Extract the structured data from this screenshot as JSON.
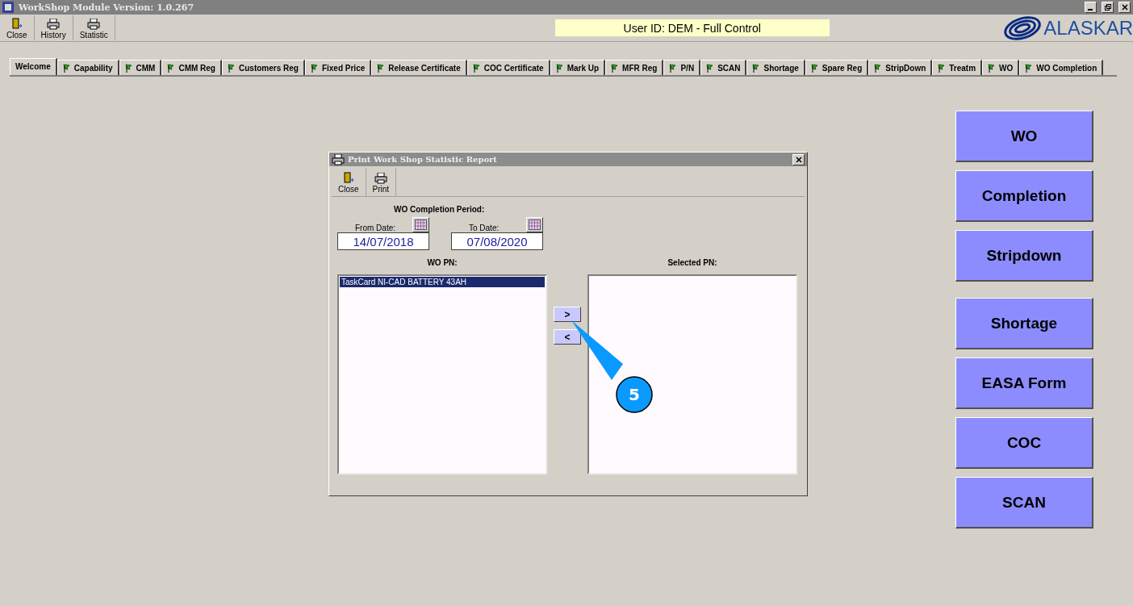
{
  "window": {
    "title": "WorkShop Module  Version: 1.0.267"
  },
  "toolbar": [
    {
      "label": "Close",
      "kind": "door"
    },
    {
      "label": "History",
      "kind": "printer"
    },
    {
      "label": "Statistic",
      "kind": "printer"
    }
  ],
  "user_banner": "User ID: DEM - Full Control",
  "logo": {
    "text": "ALASKAR"
  },
  "tabs": [
    {
      "label": "Welcome",
      "selected": true,
      "flag": false
    },
    {
      "label": "Capability",
      "selected": false,
      "flag": true
    },
    {
      "label": "CMM",
      "selected": false,
      "flag": true
    },
    {
      "label": "CMM Reg",
      "selected": false,
      "flag": true
    },
    {
      "label": "Customers Reg",
      "selected": false,
      "flag": true
    },
    {
      "label": "Fixed Price",
      "selected": false,
      "flag": true
    },
    {
      "label": "Release Certificate",
      "selected": false,
      "flag": true
    },
    {
      "label": "COC Certificate",
      "selected": false,
      "flag": true
    },
    {
      "label": "Mark Up",
      "selected": false,
      "flag": true
    },
    {
      "label": "MFR Reg",
      "selected": false,
      "flag": true
    },
    {
      "label": "P/N",
      "selected": false,
      "flag": true
    },
    {
      "label": "SCAN",
      "selected": false,
      "flag": true
    },
    {
      "label": "Shortage",
      "selected": false,
      "flag": true
    },
    {
      "label": "Spare Reg",
      "selected": false,
      "flag": true
    },
    {
      "label": "StripDown",
      "selected": false,
      "flag": true
    },
    {
      "label": "Treatm",
      "selected": false,
      "flag": true
    },
    {
      "label": "WO",
      "selected": false,
      "flag": true
    },
    {
      "label": "WO Completion",
      "selected": false,
      "flag": true
    }
  ],
  "dialog": {
    "title": "Print Work Shop Statistic Report",
    "toolbar": [
      {
        "label": "Close",
        "kind": "door"
      },
      {
        "label": "Print",
        "kind": "printer"
      }
    ],
    "period_label": "WO Completion Period:",
    "from_date": {
      "label": "From Date:",
      "value": "14/07/2018"
    },
    "to_date": {
      "label": "To Date:",
      "value": "07/08/2020"
    },
    "wo_pn": {
      "label": "WO PN:",
      "items": [
        {
          "text": "TaskCard  NI-CAD BATTERY 43AH",
          "selected": true
        }
      ]
    },
    "move_buttons": [
      ">",
      "<"
    ],
    "selected_pn": {
      "label": "Selected PN:"
    }
  },
  "callout": {
    "number": "5"
  },
  "side_button_groups": [
    {
      "buttons": [
        "WO",
        "Completion",
        "Stripdown"
      ]
    },
    {
      "buttons": [
        "Shortage",
        "EASA Form",
        "COC",
        "SCAN"
      ]
    }
  ]
}
